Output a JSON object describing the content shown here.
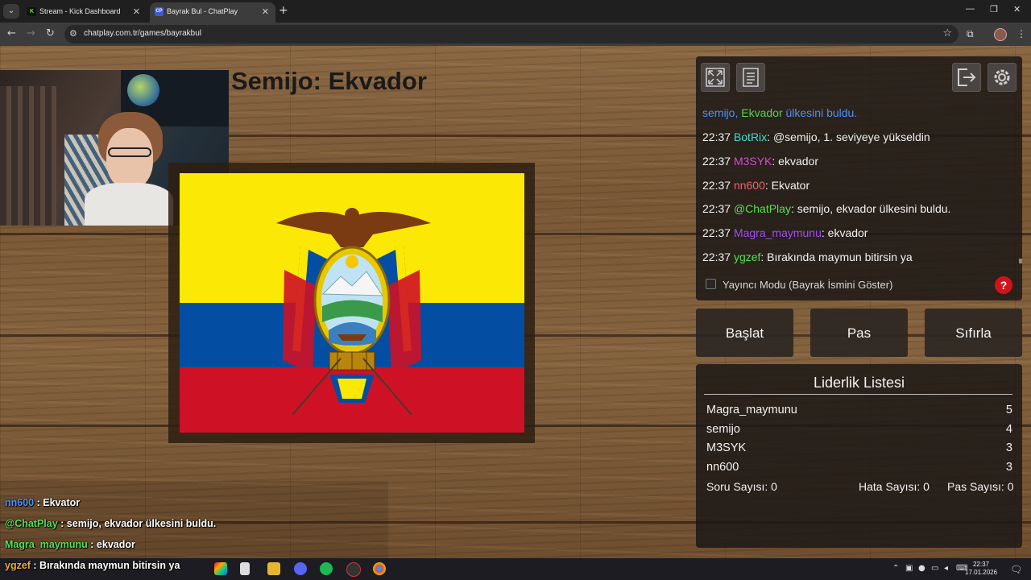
{
  "browser": {
    "tabs": [
      {
        "title": "Stream - Kick Dashboard",
        "favicon": "K",
        "favicon_color": "#53fc18",
        "active": false
      },
      {
        "title": "Bayrak Bul - ChatPlay",
        "favicon": "CP",
        "favicon_color": "#3b5bdb",
        "active": true
      }
    ],
    "url": "chatplay.com.tr/games/bayrakbul"
  },
  "game": {
    "title": "Semijo: Ekvador",
    "flag_country": "Ecuador"
  },
  "chat_panel": {
    "messages": [
      {
        "time": "",
        "user": "",
        "user_color": "#4f8ff7",
        "text": "semijo, Ekvador ülkesini buldu."
      },
      {
        "time": "22:37",
        "user": "BotRix",
        "user_color": "#3fe0d0",
        "text": ": @semijo, 1. seviyeye yükseldin"
      },
      {
        "time": "22:37",
        "user": "M3SYK",
        "user_color": "#d44bd6",
        "text": ": ekvador"
      },
      {
        "time": "22:37",
        "user": "nn600",
        "user_color": "#f06070",
        "text": ": Ekvator"
      },
      {
        "time": "22:37",
        "user": "@ChatPlay",
        "user_color": "#55e055",
        "text": ": semijo, ekvador ülkesini buldu."
      },
      {
        "time": "22:37",
        "user": "Magra_maymunu",
        "user_color": "#a050f0",
        "text": ": ekvador"
      },
      {
        "time": "22:37",
        "user": "ygzef",
        "user_color": "#55e055",
        "text": ": Bırakında maymun bitirsin ya"
      }
    ],
    "first_line": {
      "user": "semijo,",
      "country": "Ekvador",
      "rest": "ülkesini buldu.",
      "user_color": "#4f8ff7",
      "country_color": "#55d055",
      "rest_color": "#4f8ff7"
    },
    "streamer_mode_label": "Yayıncı Modu (Bayrak İsmini Göster)",
    "help_label": "?"
  },
  "actions": {
    "start": "Başlat",
    "pass": "Pas",
    "reset": "Sıfırla"
  },
  "leaderboard": {
    "title": "Liderlik Listesi",
    "rows": [
      {
        "name": "Magra_maymunu",
        "score": "5"
      },
      {
        "name": "semijo",
        "score": "4"
      },
      {
        "name": "M3SYK",
        "score": "3"
      },
      {
        "name": "nn600",
        "score": "3"
      }
    ],
    "question_count": "Soru Sayısı: 0",
    "error_count": "Hata Sayısı: 0",
    "pass_count": "Pas Sayısı: 0"
  },
  "overlay_chat": [
    {
      "user": "nn600",
      "user_color": "#4f8ff7",
      "text": " : Ekvator"
    },
    {
      "user": "@ChatPlay",
      "user_color": "#55e055",
      "text": " : semijo, ekvador ülkesini buldu."
    },
    {
      "user": "Magra_maymunu",
      "user_color": "#55e055",
      "text": " : ekvador"
    },
    {
      "user": "ygzef",
      "user_color": "#f0b030",
      "text": " : Bırakında maymun bitirsin ya"
    }
  ],
  "taskbar": {
    "time": "22:37",
    "date": "17.01.2026"
  }
}
